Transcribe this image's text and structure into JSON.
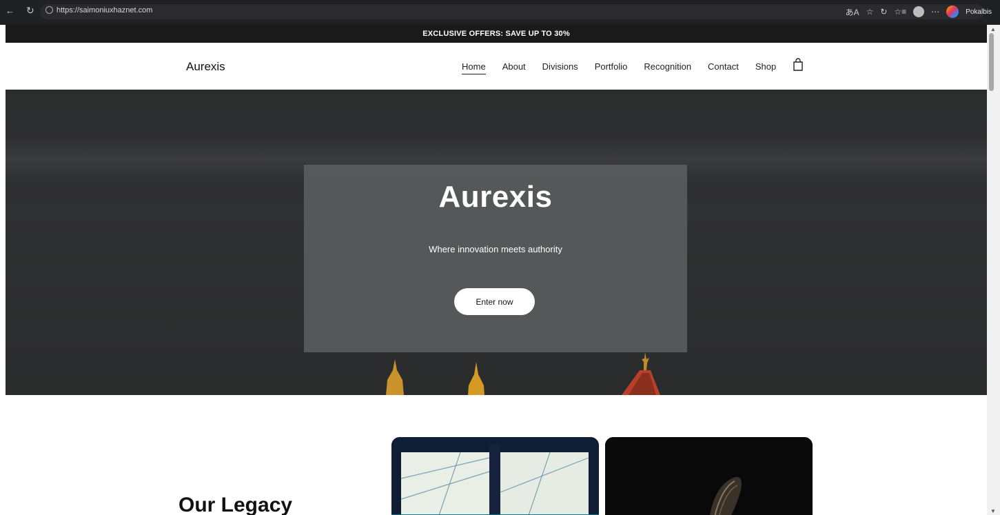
{
  "browser": {
    "url": "https://saimoniuxhaznet.com",
    "profile_label": "Pokalbis"
  },
  "promo": {
    "text": "EXCLUSIVE OFFERS: SAVE UP TO 30%"
  },
  "header": {
    "brand": "Aurexis",
    "nav": [
      {
        "label": "Home",
        "active": true
      },
      {
        "label": "About",
        "active": false
      },
      {
        "label": "Divisions",
        "active": false
      },
      {
        "label": "Portfolio",
        "active": false
      },
      {
        "label": "Recognition",
        "active": false
      },
      {
        "label": "Contact",
        "active": false
      },
      {
        "label": "Shop",
        "active": false
      }
    ],
    "cart_icon": "shopping-bag-icon"
  },
  "hero": {
    "title": "Aurexis",
    "subtitle": "Where innovation meets authority",
    "cta_label": "Enter now"
  },
  "legacy": {
    "title": "Our Legacy"
  },
  "colors": {
    "promo_bg": "#1a1a1a",
    "hero_bg": "#2e2f30",
    "hero_card": "#5f6061",
    "button_bg": "#ffffff"
  }
}
